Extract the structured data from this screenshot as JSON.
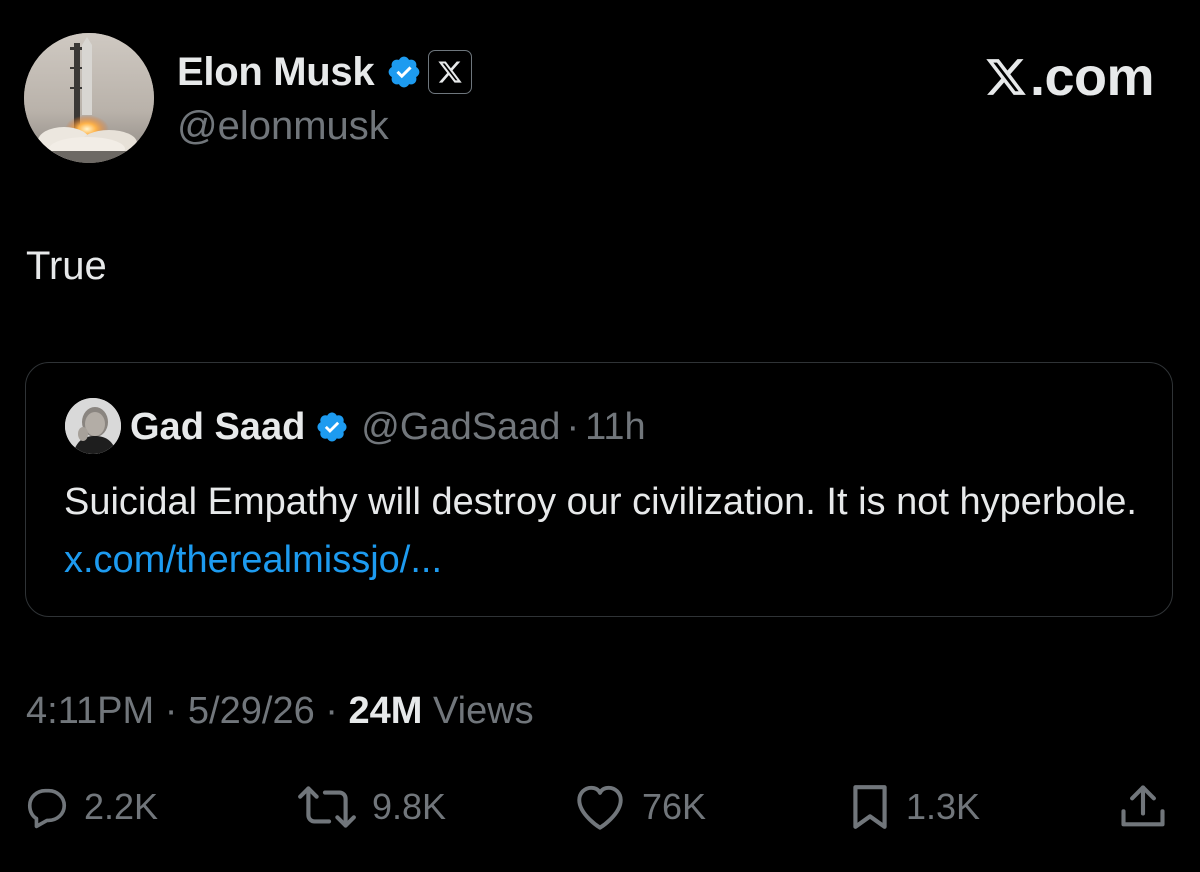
{
  "author": {
    "name": "Elon Musk",
    "handle": "@elonmusk",
    "verified": true,
    "affiliation_icon": "x-logo-icon"
  },
  "brand": {
    "label": ".com"
  },
  "tweet": {
    "text": "True"
  },
  "quoted_tweet": {
    "name": "Gad Saad",
    "handle": "@GadSaad",
    "separator": "·",
    "time": "11h",
    "verified": true,
    "text": "Suicidal Empathy will destroy our civilization. It is not hyperbole.",
    "link": "x.com/therealmissjo/..."
  },
  "meta": {
    "time": "4:11PM",
    "separator": "·",
    "date": "5/29/26",
    "views_count": "24M",
    "views_label": "Views"
  },
  "actions": {
    "replies": "2.2K",
    "reposts": "9.8K",
    "likes": "76K",
    "bookmarks": "1.3K",
    "share_icon": "share-icon"
  },
  "colors": {
    "background": "#000000",
    "primary_text": "#e7e9ea",
    "secondary_text": "#71767b",
    "link": "#1d9bf0",
    "verified": "#1d9bf0",
    "card_border": "#2f3336"
  }
}
